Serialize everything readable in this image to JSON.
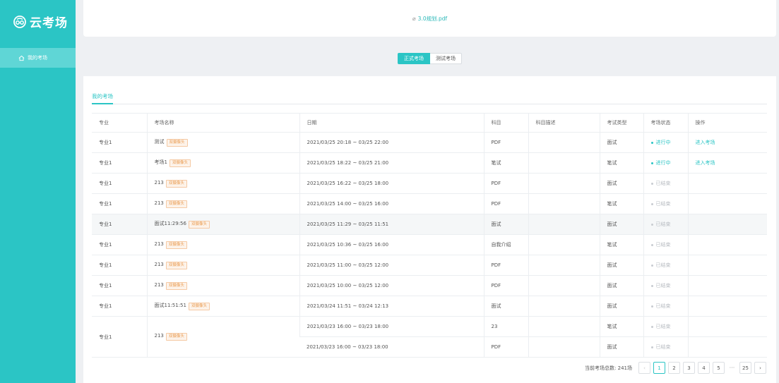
{
  "app": {
    "logo_text": "云考场",
    "nav_item": "我的考场",
    "accent_color": "#2bc5c5"
  },
  "top": {
    "file_link": "3.0规划.pdf"
  },
  "switcher": {
    "formal": "正式考场",
    "test": "测试考场"
  },
  "tabs": {
    "active": "我的考场"
  },
  "table": {
    "headers": [
      "专业",
      "考场名称",
      "日期",
      "科目",
      "科目描述",
      "考试类型",
      "考场状态",
      "操作"
    ],
    "tag_label": "双摄像头",
    "rows": [
      {
        "major": "专业1",
        "name": "测试",
        "date": "2021/03/25 20:18 ~ 03/25 22:00",
        "subject": "PDF",
        "desc": "",
        "type": "面试",
        "status": "进行中",
        "action": "进入考场"
      },
      {
        "major": "专业1",
        "name": "考场1",
        "date": "2021/03/25 18:22 ~ 03/25 21:00",
        "subject": "笔试",
        "desc": "",
        "type": "笔试",
        "status": "进行中",
        "action": "进入考场"
      },
      {
        "major": "专业1",
        "name": "213",
        "date": "2021/03/25 16:22 ~ 03/25 18:00",
        "subject": "PDF",
        "desc": "",
        "type": "面试",
        "status": "已结束",
        "action": ""
      },
      {
        "major": "专业1",
        "name": "213",
        "date": "2021/03/25 14:00 ~ 03/25 16:00",
        "subject": "PDF",
        "desc": "",
        "type": "笔试",
        "status": "已结束",
        "action": ""
      },
      {
        "major": "专业1",
        "name": "面试11:29:56",
        "date": "2021/03/25 11:29 ~ 03/25 11:51",
        "subject": "面试",
        "desc": "",
        "type": "面试",
        "status": "已结束",
        "action": ""
      },
      {
        "major": "专业1",
        "name": "213",
        "date": "2021/03/25 10:36 ~ 03/25 16:00",
        "subject": "自我介绍",
        "desc": "",
        "type": "笔试",
        "status": "已结束",
        "action": ""
      },
      {
        "major": "专业1",
        "name": "213",
        "date": "2021/03/25 11:00 ~ 03/25 12:00",
        "subject": "PDF",
        "desc": "",
        "type": "面试",
        "status": "已结束",
        "action": ""
      },
      {
        "major": "专业1",
        "name": "213",
        "date": "2021/03/25 10:00 ~ 03/25 12:00",
        "subject": "PDF",
        "desc": "",
        "type": "面试",
        "status": "已结束",
        "action": ""
      },
      {
        "major": "专业1",
        "name": "面试11:51:51",
        "date": "2021/03/24 11:51 ~ 03/24 12:13",
        "subject": "面试",
        "desc": "",
        "type": "面试",
        "status": "已结束",
        "action": ""
      }
    ],
    "merged_row": {
      "major": "专业1",
      "name": "213",
      "sub": [
        {
          "date": "2021/03/23 16:00 ~ 03/23 18:00",
          "subject": "23",
          "desc": "",
          "type": "笔试",
          "status": "已结束",
          "action": ""
        },
        {
          "date": "2021/03/23 16:00 ~ 03/23 18:00",
          "subject": "PDF",
          "desc": "",
          "type": "面试",
          "status": "已结束",
          "action": ""
        }
      ]
    }
  },
  "pager": {
    "total_text": "当前考场总数: 241场",
    "prev": "‹",
    "next": "›",
    "pages": [
      "1",
      "2",
      "3",
      "4",
      "5"
    ],
    "ellipsis": "···",
    "last": "25",
    "current": "1"
  }
}
